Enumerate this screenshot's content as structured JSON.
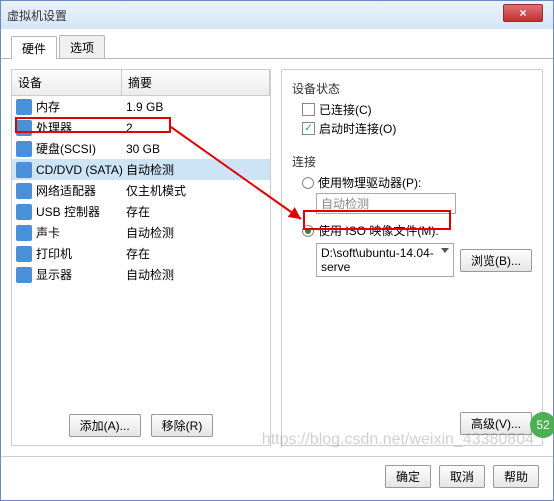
{
  "window": {
    "title": "虚拟机设置",
    "close": "×"
  },
  "tabs": [
    {
      "label": "硬件"
    },
    {
      "label": "选项"
    }
  ],
  "list": {
    "headers": {
      "device": "设备",
      "summary": "摘要"
    },
    "items": [
      {
        "icon": "chip",
        "name": "内存",
        "summary": "1.9 GB"
      },
      {
        "icon": "cpu",
        "name": "处理器",
        "summary": "2"
      },
      {
        "icon": "disk",
        "name": "硬盘(SCSI)",
        "summary": "30 GB"
      },
      {
        "icon": "cd",
        "name": "CD/DVD (SATA)",
        "summary": "自动检测"
      },
      {
        "icon": "net",
        "name": "网络适配器",
        "summary": "仅主机模式"
      },
      {
        "icon": "usb",
        "name": "USB 控制器",
        "summary": "存在"
      },
      {
        "icon": "sound",
        "name": "声卡",
        "summary": "自动检测"
      },
      {
        "icon": "printer",
        "name": "打印机",
        "summary": "存在"
      },
      {
        "icon": "display",
        "name": "显示器",
        "summary": "自动检测"
      }
    ],
    "selected_index": 3,
    "buttons": {
      "add": "添加(A)...",
      "remove": "移除(R)"
    }
  },
  "right": {
    "status_title": "设备状态",
    "connected": "已连接(C)",
    "connect_at_power_on": "启动时连接(O)",
    "connection_title": "连接",
    "use_physical": "使用物理驱动器(P):",
    "physical_value": "自动检测",
    "use_iso": "使用 ISO 映像文件(M):",
    "iso_path": "D:\\soft\\ubuntu-14.04-serve",
    "browse": "浏览(B)...",
    "advanced": "高级(V)..."
  },
  "footer": {
    "ok": "确定",
    "cancel": "取消",
    "help": "帮助"
  },
  "watermark": "https://blog.csdn.net/weixin_43380804",
  "badge": "52",
  "icon_colors": {
    "chip": "#4a90d9",
    "cpu": "#4a90d9",
    "disk": "#4a90d9",
    "cd": "#4a90d9",
    "net": "#4a90d9",
    "usb": "#4a90d9",
    "sound": "#4a90d9",
    "printer": "#4a90d9",
    "display": "#4a90d9"
  }
}
